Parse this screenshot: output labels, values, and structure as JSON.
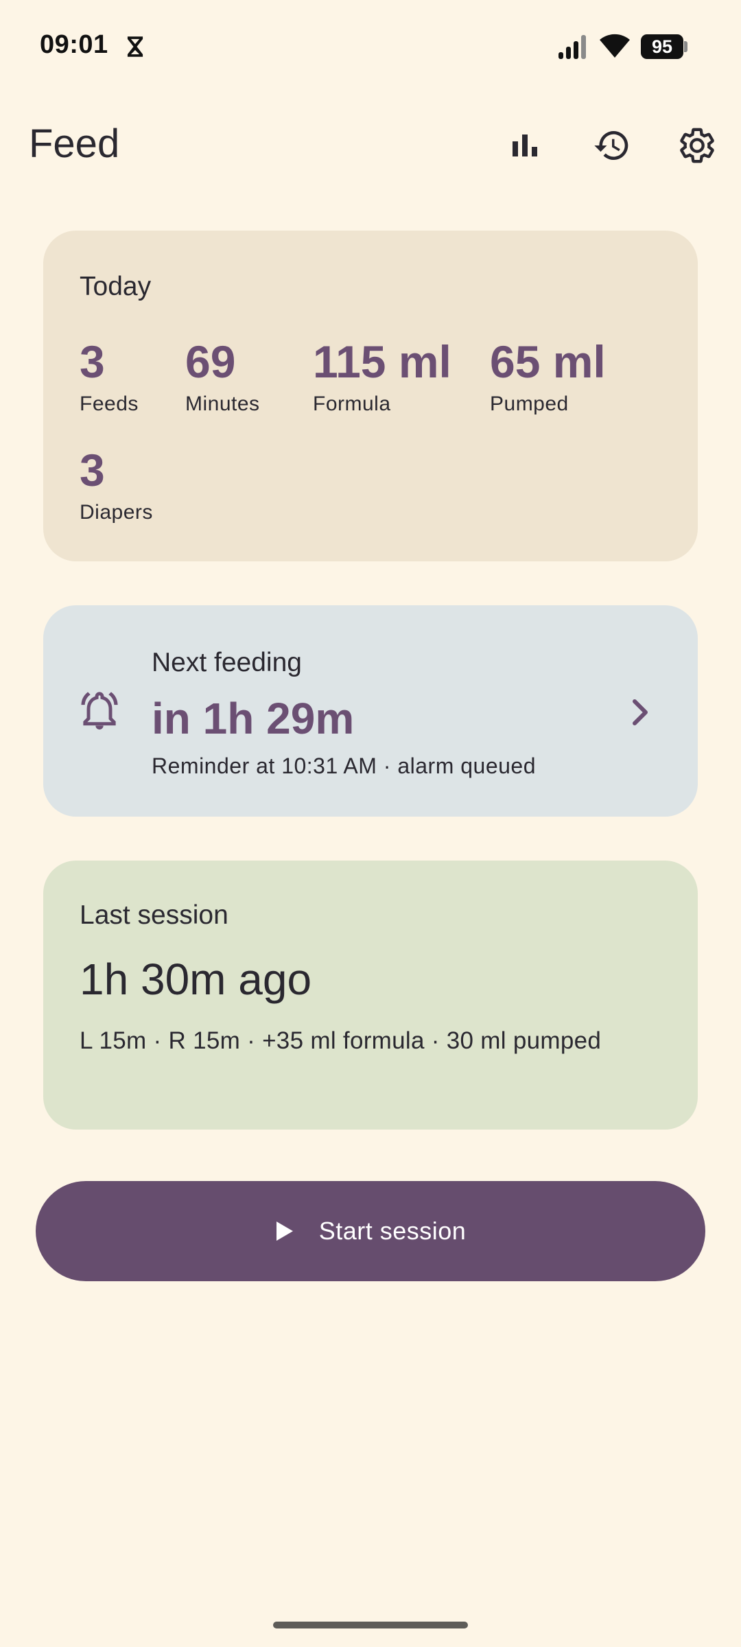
{
  "status_bar": {
    "time": "09:01",
    "battery": "95",
    "icons": [
      "hourglass-icon",
      "signal-icon",
      "wifi-icon",
      "battery-icon"
    ]
  },
  "app_bar": {
    "title": "Feed",
    "actions": [
      "bar-chart-icon",
      "history-icon",
      "settings-gear-icon"
    ]
  },
  "today": {
    "heading": "Today",
    "stats": [
      {
        "value": "3",
        "label": "Feeds"
      },
      {
        "value": "69",
        "label": "Minutes"
      },
      {
        "value": "115 ml",
        "label": "Formula"
      },
      {
        "value": "65 ml",
        "label": "Pumped"
      },
      {
        "value": "3",
        "label": "Diapers"
      }
    ]
  },
  "next_feeding": {
    "heading": "Next feeding",
    "value": "in 1h 29m",
    "subtitle": "Reminder at 10:31 AM · alarm queued",
    "icon": "alarm-bell-icon"
  },
  "last_session": {
    "heading": "Last session",
    "ago": "1h 30m ago",
    "detail": "L 15m  ·  R 15m  ·  +35 ml formula  ·  30 ml pumped"
  },
  "start_button": {
    "label": "Start session",
    "icon": "play-icon"
  },
  "colors": {
    "background": "#fdf5e6",
    "accent": "#6b4f73",
    "button": "#664d6e",
    "today_card": "#efe4d0",
    "next_card": "#dde4e6",
    "last_card": "#dde4cc"
  }
}
